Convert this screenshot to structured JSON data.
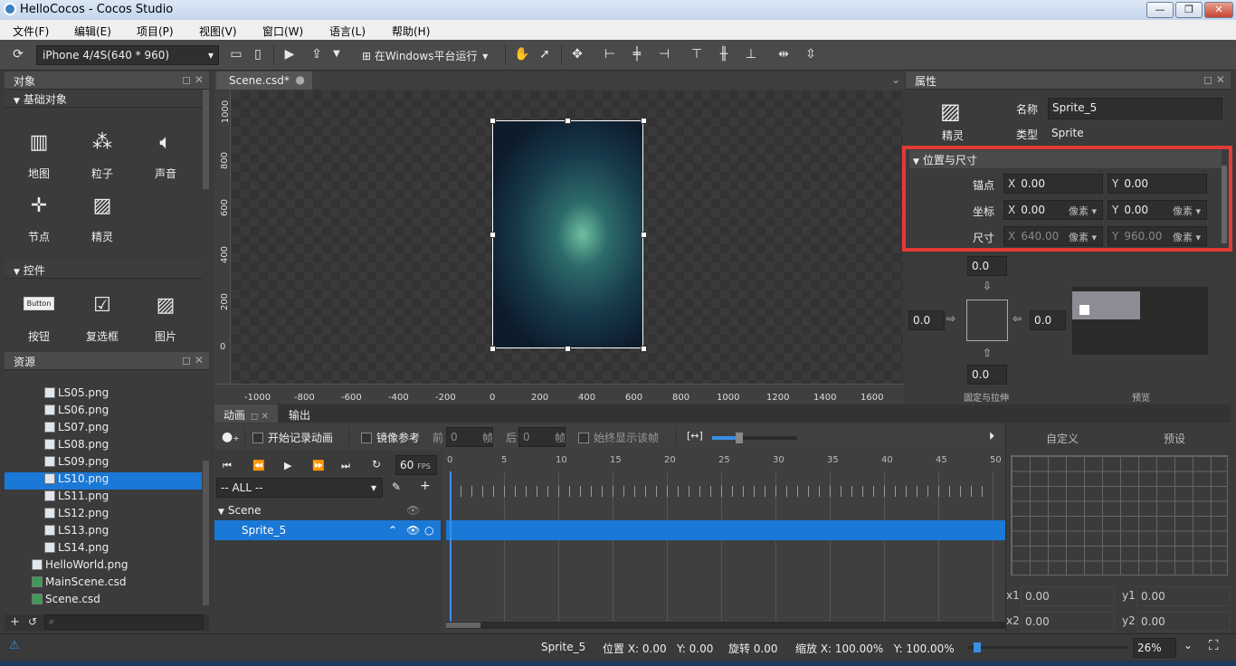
{
  "window": {
    "title": "HelloCocos - Cocos Studio",
    "btn_min": "—",
    "btn_max": "❐",
    "btn_close": "✕"
  },
  "menu": [
    "文件(F)",
    "编辑(E)",
    "项目(P)",
    "视图(V)",
    "窗口(W)",
    "语言(L)",
    "帮助(H)"
  ],
  "toolbar": {
    "device": "iPhone 4/4S(640 * 960)",
    "run_target": "在Windows平台运行"
  },
  "objects_panel": {
    "title": "对象",
    "basic_header": "基础对象",
    "basic_items": [
      {
        "label": "地图",
        "icon": "map-icon"
      },
      {
        "label": "粒子",
        "icon": "particle-icon"
      },
      {
        "label": "声音",
        "icon": "sound-icon"
      },
      {
        "label": "节点",
        "icon": "node-icon"
      },
      {
        "label": "精灵",
        "icon": "sprite-icon"
      }
    ],
    "controls_header": "控件",
    "control_items": [
      {
        "label": "按钮",
        "icon": "button-icon",
        "sub": "Button"
      },
      {
        "label": "复选框",
        "icon": "checkbox-icon"
      },
      {
        "label": "图片",
        "icon": "image-icon"
      }
    ]
  },
  "resources_panel": {
    "title": "资源",
    "files": [
      {
        "name": "LS05.png",
        "type": "png",
        "indent": 1,
        "selected": false
      },
      {
        "name": "LS06.png",
        "type": "png",
        "indent": 1,
        "selected": false
      },
      {
        "name": "LS07.png",
        "type": "png",
        "indent": 1,
        "selected": false
      },
      {
        "name": "LS08.png",
        "type": "png",
        "indent": 1,
        "selected": false
      },
      {
        "name": "LS09.png",
        "type": "png",
        "indent": 1,
        "selected": false
      },
      {
        "name": "LS10.png",
        "type": "png",
        "indent": 1,
        "selected": true
      },
      {
        "name": "LS11.png",
        "type": "png",
        "indent": 1,
        "selected": false
      },
      {
        "name": "LS12.png",
        "type": "png",
        "indent": 1,
        "selected": false
      },
      {
        "name": "LS13.png",
        "type": "png",
        "indent": 1,
        "selected": false
      },
      {
        "name": "LS14.png",
        "type": "png",
        "indent": 1,
        "selected": false
      },
      {
        "name": "HelloWorld.png",
        "type": "png",
        "indent": 0,
        "selected": false
      },
      {
        "name": "MainScene.csd",
        "type": "csd",
        "indent": 0,
        "selected": false
      },
      {
        "name": "Scene.csd",
        "type": "csd",
        "indent": 0,
        "selected": false
      }
    ]
  },
  "editor": {
    "tab": "Scene.csd*",
    "ruler_x": [
      "-1000",
      "-800",
      "-600",
      "-400",
      "-200",
      "0",
      "200",
      "400",
      "600",
      "800",
      "1000",
      "1200",
      "1400",
      "1600"
    ],
    "ruler_y": [
      "1000",
      "800",
      "600",
      "400",
      "200",
      "0"
    ]
  },
  "properties": {
    "title": "属性",
    "sprite_label": "精灵",
    "name_label": "名称",
    "name_value": "Sprite_5",
    "type_label": "类型",
    "type_value": "Sprite",
    "section": "位置与尺寸",
    "anchor_label": "锚点",
    "anchor_x": "0.00",
    "anchor_y": "0.00",
    "pos_label": "坐标",
    "pos_x": "0.00",
    "pos_y": "0.00",
    "size_label": "尺寸",
    "size_x": "640.00",
    "size_y": "960.00",
    "unit": "像素",
    "stretch_top": "0.0",
    "stretch_left": "0.0",
    "stretch_right": "0.0",
    "stretch_bottom": "0.0",
    "stretch_caption": "固定与拉伸",
    "preview_caption": "预览",
    "highlight_color": "#e53935"
  },
  "animation": {
    "tab_anim": "动画",
    "tab_output": "输出",
    "record_label": "开始记录动画",
    "mirror_label": "镜像参考",
    "before_label": "前",
    "before_value": "0",
    "after_label": "后",
    "after_value": "0",
    "frame_unit": "帧",
    "always_show_label": "始终显示该帧",
    "fps_value": "60",
    "fps_label": "FPS",
    "filter": "-- ALL --",
    "tree_scene": "Scene",
    "tree_sprite": "Sprite_5",
    "timeline_ticks": [
      "0",
      "5",
      "10",
      "15",
      "20",
      "25",
      "30",
      "35",
      "40",
      "45",
      "50"
    ],
    "tab_custom": "自定义",
    "tab_preset": "预设",
    "x1_label": "x1",
    "x1_value": "0.00",
    "y1_label": "y1",
    "y1_value": "0.00",
    "x2_label": "x2",
    "x2_value": "0.00",
    "y2_label": "y2",
    "y2_value": "0.00"
  },
  "status": {
    "object": "Sprite_5",
    "position": "位置 X: 0.00   Y: 0.00",
    "rotation": "旋转 0.00",
    "scale": "缩放 X: 100.00%   Y: 100.00%",
    "zoom": "26%"
  }
}
